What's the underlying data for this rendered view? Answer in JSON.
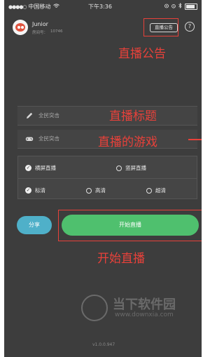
{
  "status_bar": {
    "signal_dots": "●●●●○",
    "carrier": "中国移动",
    "wifi_icon": "wifi-icon",
    "time": "下午3:36",
    "battery_fill_fraction": 0.75
  },
  "user": {
    "name": "Junior",
    "id_label": "房间号：",
    "id_value": "10746"
  },
  "header": {
    "announcement_label": "直播公告",
    "help_label": "?"
  },
  "annotations": {
    "announcement": "直播公告",
    "title": "直播标题",
    "game": "直播的游戏",
    "start": "开始直播"
  },
  "form": {
    "title_value": "全民突击",
    "game_value": "全民突击",
    "orientation": {
      "landscape_label": "横屏直播",
      "portrait_label": "竖屏直播",
      "selected": "landscape"
    },
    "quality": {
      "sd_label": "标清",
      "hd_label": "高清",
      "uhd_label": "超清",
      "selected": "sd"
    }
  },
  "actions": {
    "share_label": "分享",
    "start_label": "开始直播"
  },
  "watermark": {
    "site_name": "当下软件园",
    "url": "www.downxia.com"
  },
  "version": "v1.0.0.947",
  "colors": {
    "background": "#3d3d3d",
    "annotation_red": "#e8413a",
    "start_green": "#4fc06e",
    "share_blue": "#4fb0c9"
  }
}
